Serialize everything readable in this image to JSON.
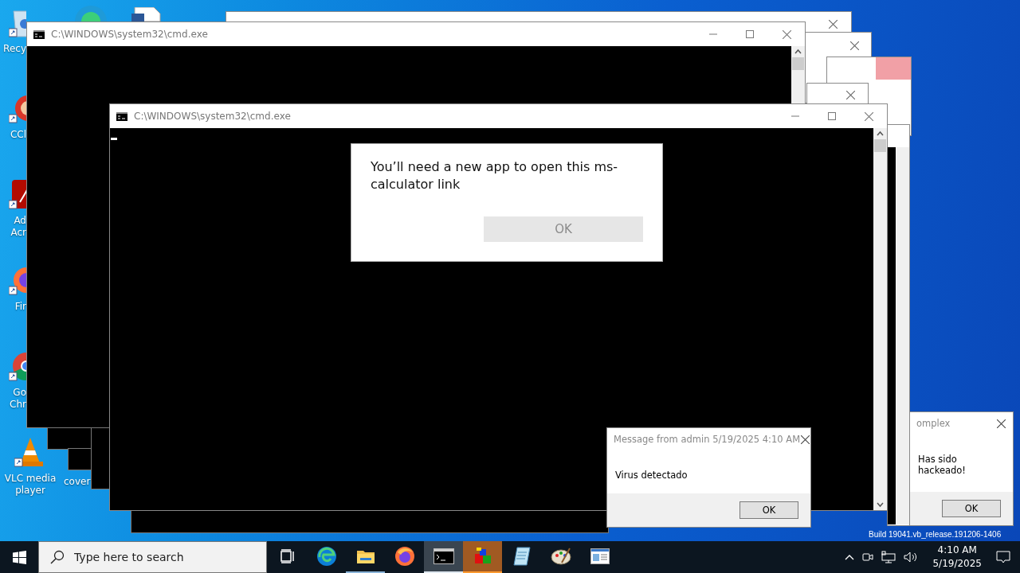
{
  "desktop": {
    "icons": [
      {
        "kind": "recycle-bin",
        "lines": [
          "Recy"
        ]
      },
      {
        "kind": "ccleaner",
        "lines": [
          "CCl"
        ]
      },
      {
        "kind": "acrobat",
        "lines": [
          "Ad",
          "Acr"
        ]
      },
      {
        "kind": "firefox",
        "lines": [
          "Fir"
        ]
      },
      {
        "kind": "chrome",
        "lines": [
          "Go",
          "Chr"
        ]
      },
      {
        "kind": "vlc",
        "lines": [
          "VLC media",
          "player"
        ]
      }
    ],
    "file_label": "cover",
    "build_text": "Build 19041.vb_release.191206-1406"
  },
  "windows": [
    {
      "title": "C:\\WINDOWS\\system32\\cmd.exe"
    },
    {
      "title": "C:\\WINDOWS\\system32\\cmd.exe",
      "cursor": true
    }
  ],
  "dialog": {
    "text": "You’ll need a new app to open this ms-calculator link",
    "button": {
      "label": "OK",
      "disabled": true
    }
  },
  "message_boxes": [
    {
      "title": "Message from admin 5/19/2025 4:10 AM",
      "text": "Virus detectado",
      "button": "OK"
    },
    {
      "title": "omplex",
      "text": "Has sido hackeado!",
      "button": "OK"
    }
  ],
  "taskbar": {
    "search_placeholder": "Type here to search",
    "apps": [
      {
        "kind": "task-view",
        "running": false,
        "selected": false,
        "flashing": false
      },
      {
        "kind": "edge",
        "running": false,
        "selected": false,
        "flashing": false
      },
      {
        "kind": "folder",
        "running": true,
        "selected": false,
        "flashing": false
      },
      {
        "kind": "firefox",
        "running": false,
        "selected": false,
        "flashing": false
      },
      {
        "kind": "terminal",
        "running": true,
        "selected": true,
        "flashing": false
      },
      {
        "kind": "cubes",
        "running": true,
        "selected": false,
        "flashing": true
      },
      {
        "kind": "notepad",
        "running": false,
        "selected": false,
        "flashing": false
      },
      {
        "kind": "palette",
        "running": false,
        "selected": false,
        "flashing": false
      },
      {
        "kind": "window",
        "running": false,
        "selected": false,
        "flashing": false
      }
    ],
    "time": "4:10 AM",
    "date": "5/19/2025"
  }
}
